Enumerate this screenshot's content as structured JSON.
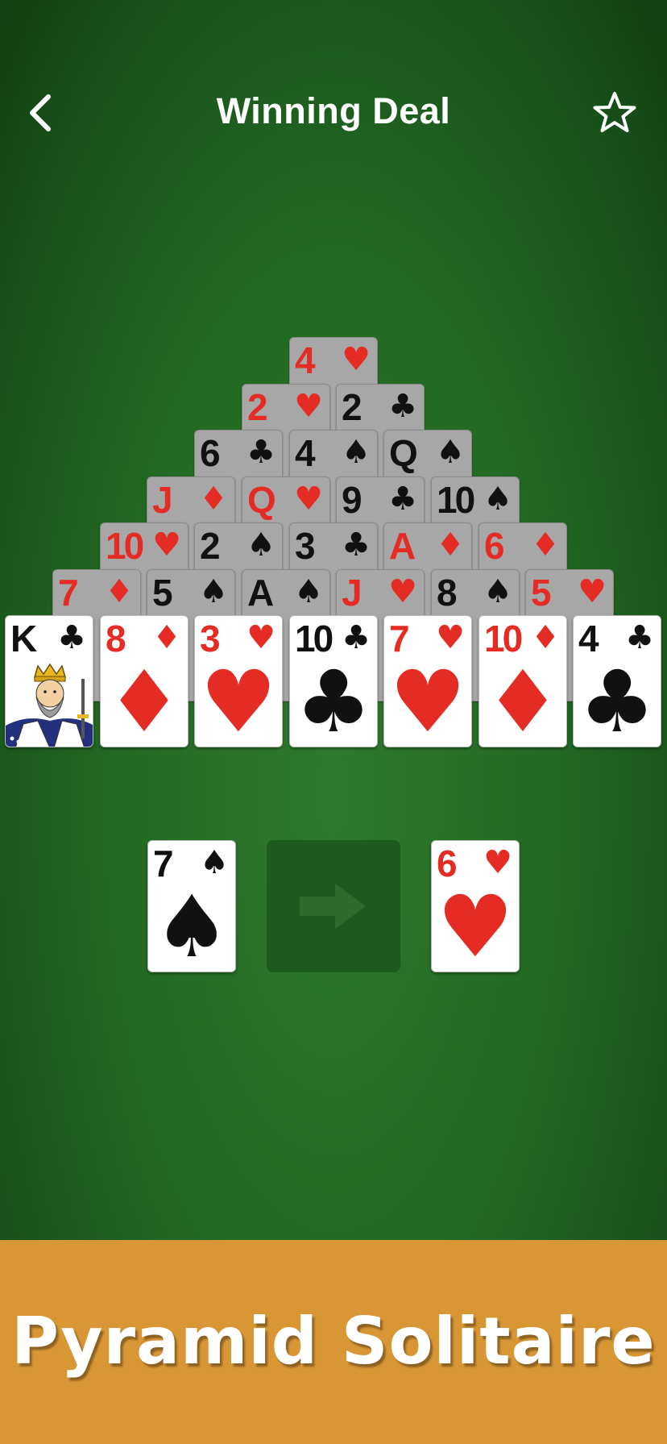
{
  "header": {
    "title": "Winning Deal",
    "back_icon": "chevron-left-icon",
    "favorite_icon": "star-outline-icon"
  },
  "pyramid": {
    "rows": [
      [
        {
          "rank": "4",
          "suit": "♥",
          "color": "red"
        }
      ],
      [
        {
          "rank": "2",
          "suit": "♥",
          "color": "red"
        },
        {
          "rank": "2",
          "suit": "♣",
          "color": "black"
        }
      ],
      [
        {
          "rank": "6",
          "suit": "♣",
          "color": "black"
        },
        {
          "rank": "4",
          "suit": "♠",
          "color": "black"
        },
        {
          "rank": "Q",
          "suit": "♠",
          "color": "black"
        }
      ],
      [
        {
          "rank": "J",
          "suit": "♦",
          "color": "red"
        },
        {
          "rank": "Q",
          "suit": "♥",
          "color": "red"
        },
        {
          "rank": "9",
          "suit": "♣",
          "color": "black"
        },
        {
          "rank": "10",
          "suit": "♠",
          "color": "black"
        }
      ],
      [
        {
          "rank": "10",
          "suit": "♥",
          "color": "red"
        },
        {
          "rank": "2",
          "suit": "♠",
          "color": "black"
        },
        {
          "rank": "3",
          "suit": "♣",
          "color": "black"
        },
        {
          "rank": "A",
          "suit": "♦",
          "color": "red"
        },
        {
          "rank": "6",
          "suit": "♦",
          "color": "red"
        }
      ],
      [
        {
          "rank": "7",
          "suit": "♦",
          "color": "red"
        },
        {
          "rank": "5",
          "suit": "♠",
          "color": "black"
        },
        {
          "rank": "A",
          "suit": "♠",
          "color": "black"
        },
        {
          "rank": "J",
          "suit": "♥",
          "color": "red"
        },
        {
          "rank": "8",
          "suit": "♠",
          "color": "black"
        },
        {
          "rank": "5",
          "suit": "♥",
          "color": "red"
        }
      ],
      [
        {
          "rank": "K",
          "suit": "♣",
          "color": "black",
          "face": true
        },
        {
          "rank": "8",
          "suit": "♦",
          "color": "red"
        },
        {
          "rank": "3",
          "suit": "♥",
          "color": "red"
        },
        {
          "rank": "10",
          "suit": "♣",
          "color": "black"
        },
        {
          "rank": "7",
          "suit": "♥",
          "color": "red"
        },
        {
          "rank": "10",
          "suit": "♦",
          "color": "red"
        },
        {
          "rank": "4",
          "suit": "♣",
          "color": "black"
        }
      ]
    ]
  },
  "stock_card": {
    "rank": "7",
    "suit": "♠",
    "color": "black"
  },
  "waste_button": {
    "icon": "arrow-right-icon"
  },
  "waste_card": {
    "rank": "6",
    "suit": "♥",
    "color": "red"
  },
  "banner": {
    "text": "Pyramid Solitaire"
  },
  "colors": {
    "red": "#e42b24",
    "black": "#111111",
    "felt": "#236a22",
    "banner": "#d89634"
  }
}
